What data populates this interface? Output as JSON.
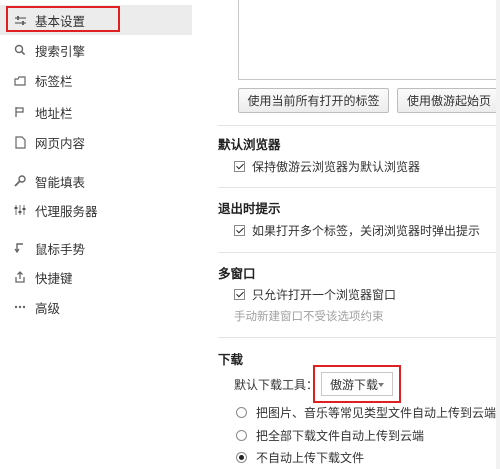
{
  "sidebar": {
    "items": [
      {
        "label": "基本设置",
        "icon": "sliders-icon"
      },
      {
        "label": "搜索引擎",
        "icon": "search-icon"
      },
      {
        "label": "标签栏",
        "icon": "tabs-icon"
      },
      {
        "label": "地址栏",
        "icon": "address-bar-icon"
      },
      {
        "label": "网页内容",
        "icon": "page-icon"
      },
      {
        "label": "智能填表",
        "icon": "wrench-icon"
      },
      {
        "label": "代理服务器",
        "icon": "proxy-icon"
      },
      {
        "label": "鼠标手势",
        "icon": "gesture-icon"
      },
      {
        "label": "快捷键",
        "icon": "shortcut-icon"
      },
      {
        "label": "高级",
        "icon": "more-icon"
      }
    ]
  },
  "startup": {
    "use_current_tabs": "使用当前所有打开的标签",
    "use_start_page": "使用傲游起始页"
  },
  "default_browser": {
    "title": "默认浏览器",
    "option": "保持傲游云浏览器为默认浏览器",
    "checked": true
  },
  "exit_prompt": {
    "title": "退出时提示",
    "option": "如果打开多个标签，关闭浏览器时弹出提示",
    "checked": true
  },
  "multi_window": {
    "title": "多窗口",
    "option": "只允许打开一个浏览器窗口",
    "checked": true,
    "hint": "手动新建窗口不受该选项约束"
  },
  "download": {
    "title": "下载",
    "tool_label": "默认下载工具：",
    "tool_value": "傲游下载",
    "options": [
      {
        "label": "把图片、音乐等常见类型文件自动上传到云端",
        "checked": false
      },
      {
        "label": "把全部下载文件自动上传到云端",
        "checked": false
      },
      {
        "label": "不自动上传下载文件",
        "checked": true
      }
    ]
  }
}
